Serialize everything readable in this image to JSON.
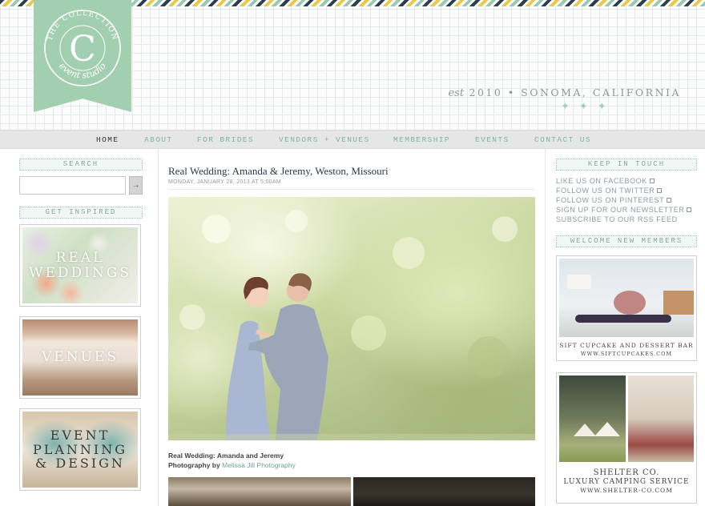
{
  "header": {
    "logo_top": "THE COLLECTION",
    "logo_letter": "C",
    "logo_bottom": "event studio",
    "tagline_est": "est",
    "tagline_text": "2010 • SONOMA, CALIFORNIA",
    "ornament": "✦✦✦"
  },
  "nav": {
    "items": [
      "HOME",
      "ABOUT",
      "FOR BRIDES",
      "VENDORS + VENUES",
      "MEMBERSHIP",
      "EVENTS",
      "CONTACT US"
    ],
    "active": "HOME"
  },
  "sidebar": {
    "search_label": "SEARCH",
    "search_value": "",
    "search_button": "→",
    "inspired_label": "GET INSPIRED",
    "tiles": [
      {
        "line1": "REAL",
        "line2": "WEDDINGS"
      },
      {
        "line1": "VENUES"
      },
      {
        "line1": "EVENT",
        "line2": "PLANNING",
        "line3": "& DESIGN"
      }
    ]
  },
  "post": {
    "title": "Real Wedding: Amanda & Jeremy, Weston, Missouri",
    "date": "MONDAY, JANUARY 28, 2013 AT 5:00AM",
    "caption_line1": "Real Wedding: Amanda and Jeremy",
    "caption_prefix": "Photography by",
    "caption_link": "Melissa Jill Photography"
  },
  "right": {
    "keep_label": "KEEP IN TOUCH",
    "social": [
      "LIKE US ON FACEBOOK",
      "FOLLOW US ON TWITTER",
      "FOLLOW US ON PINTEREST",
      "SIGN UP FOR OUR NEWSLETTER",
      "SUBSCRIBE TO OUR RSS FEED"
    ],
    "welcome_label": "WELCOME NEW MEMBERS",
    "ads": [
      {
        "line1": "SIFT CUPCAKE AND DESSERT BAR",
        "line2": "WWW.SIFTCUPCAKES.COM"
      },
      {
        "line1": "SHELTER CO.",
        "line2": "LUXURY CAMPING SERVICE",
        "line3": "WWW.SHELTER-CO.COM"
      }
    ]
  },
  "colors": {
    "accent": "#a3cfb1",
    "nav_link": "#7fb5a3",
    "title": "#2a3a4a"
  }
}
